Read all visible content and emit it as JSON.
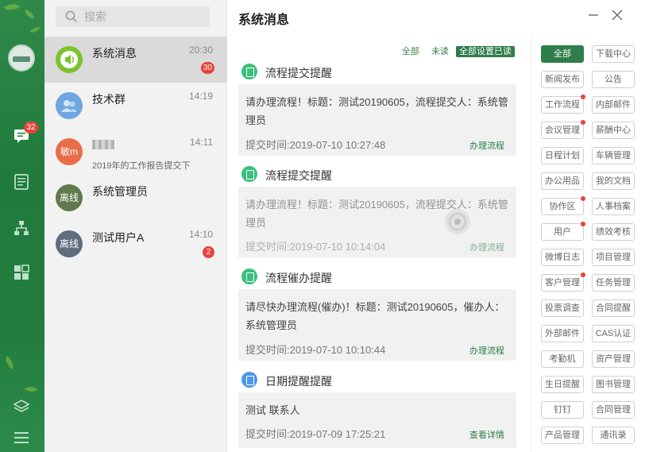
{
  "search": {
    "placeholder": "搜索"
  },
  "nav": {
    "messages_badge": "32"
  },
  "conversations": [
    {
      "name": "系统消息",
      "time": "20:30",
      "count": "30",
      "avatar_text": "",
      "avatar_color": "#7cc22e"
    },
    {
      "name": "技术群",
      "time": "14:19",
      "avatar_text": "",
      "avatar_color": "#6fa6e0"
    },
    {
      "name": "",
      "time": "14:11",
      "preview": "2019年的工作报告提交下",
      "avatar_text": "敏m",
      "avatar_color": "#e86e48"
    },
    {
      "name": "系统管理员",
      "time": "",
      "avatar_text": "离线",
      "avatar_color": "#607a4d"
    },
    {
      "name": "测试用户A",
      "time": "14:10",
      "count": "2",
      "avatar_text": "离线",
      "avatar_color": "#5f6d7e"
    }
  ],
  "header": {
    "title": "系统消息"
  },
  "filters": {
    "all": "全部",
    "unread": "未读",
    "mark_all_read": "全部设置已读"
  },
  "messages": [
    {
      "type": "流程提交提醒",
      "body": "请办理流程！标题：测试20190605，流程提交人：系统管理员",
      "time": "提交时间:2019-07-10 10:27:48",
      "action": "办理流程",
      "icon_color": "#3bbf7e"
    },
    {
      "type": "流程提交提醒",
      "body": "请办理流程！标题：测试20190605，流程提交人：系统管理员",
      "time": "提交时间:2019-07-10 10:14:04",
      "action": "办理流程",
      "icon_color": "#3bbf7e"
    },
    {
      "type": "流程催办提醒",
      "body": "请尽快办理流程(催办)！标题：测试20190605，催办人：系统管理员",
      "time": "提交时间:2019-07-10 10:10:44",
      "action": "办理流程",
      "icon_color": "#3bbf7e"
    },
    {
      "type": "日期提醒提醒",
      "body": "测试 联系人",
      "time": "提交时间:2019-07-09 17:25:21",
      "action": "查看详情",
      "icon_color": "#4b98e6"
    }
  ],
  "categories": [
    {
      "label": "全部",
      "active": true
    },
    {
      "label": "下载中心"
    },
    {
      "label": "新闻发布"
    },
    {
      "label": "公告"
    },
    {
      "label": "工作流程",
      "dot": true
    },
    {
      "label": "内部邮件"
    },
    {
      "label": "会议管理",
      "dot": true
    },
    {
      "label": "薪酬中心"
    },
    {
      "label": "日程计划"
    },
    {
      "label": "车辆管理"
    },
    {
      "label": "办公用品"
    },
    {
      "label": "我的文档"
    },
    {
      "label": "协作区",
      "dot": true
    },
    {
      "label": "人事档案"
    },
    {
      "label": "用户",
      "dot": true
    },
    {
      "label": "绩效考核"
    },
    {
      "label": "微博日志"
    },
    {
      "label": "项目管理"
    },
    {
      "label": "客户管理",
      "dot": true
    },
    {
      "label": "任务管理"
    },
    {
      "label": "投票调查"
    },
    {
      "label": "合同提醒"
    },
    {
      "label": "外部邮件"
    },
    {
      "label": "CAS认证"
    },
    {
      "label": "考勤机"
    },
    {
      "label": "资产管理"
    },
    {
      "label": "生日提醒"
    },
    {
      "label": "图书管理"
    },
    {
      "label": "钉钉"
    },
    {
      "label": "合同管理"
    },
    {
      "label": "产品管理"
    },
    {
      "label": "通讯录"
    }
  ]
}
